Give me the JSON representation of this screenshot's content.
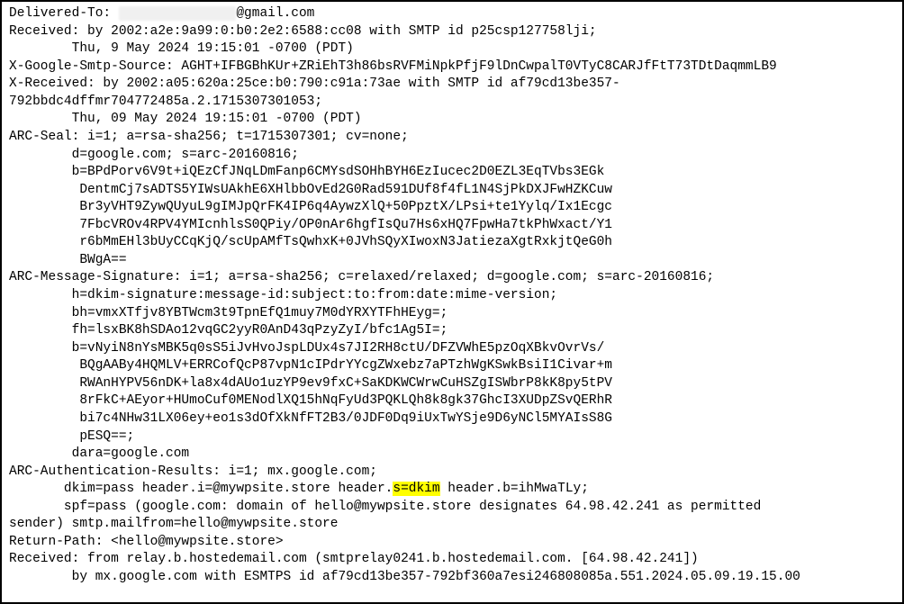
{
  "lines": {
    "l01a": "Delivered-To: ",
    "l01_redacted": "xxxxx.xxxxxxxxx",
    "l01b": "@gmail.com",
    "l02": "Received: by 2002:a2e:9a99:0:b0:2e2:6588:cc08 with SMTP id p25csp127758lji;",
    "l03": "        Thu, 9 May 2024 19:15:01 -0700 (PDT)",
    "l04": "X-Google-Smtp-Source: AGHT+IFBGBhKUr+ZRiEhT3h86bsRVFMiNpkPfjF9lDnCwpalT0VTyC8CARJfFtT73TDtDaqmmLB9",
    "l05": "X-Received: by 2002:a05:620a:25ce:b0:790:c91a:73ae with SMTP id af79cd13be357-",
    "l06": "792bbdc4dffmr704772485a.2.1715307301053;",
    "l07": "        Thu, 09 May 2024 19:15:01 -0700 (PDT)",
    "l08": "ARC-Seal: i=1; a=rsa-sha256; t=1715307301; cv=none;",
    "l09": "        d=google.com; s=arc-20160816;",
    "l10": "        b=BPdPorv6V9t+iQEzCfJNqLDmFanp6CMYsdSOHhBYH6EzIucec2D0EZL3EqTVbs3EGk",
    "l11": "         DentmCj7sADTS5YIWsUAkhE6XHlbbOvEd2G0Rad591DUf8f4fL1N4SjPkDXJFwHZKCuw",
    "l12": "         Br3yVHT9ZywQUyuL9gIMJpQrFK4IP6q4AywzXlQ+50PpztX/LPsi+te1Yylq/Ix1Ecgc",
    "l13": "         7FbcVROv4RPV4YMIcnhlsS0QPiy/OP0nAr6hgfIsQu7Hs6xHQ7FpwHa7tkPhWxact/Y1",
    "l14": "         r6bMmEHl3bUyCCqKjQ/scUpAMfTsQwhxK+0JVhSQyXIwoxN3JatiezaXgtRxkjtQeG0h",
    "l15": "         BWgA==",
    "l16": "ARC-Message-Signature: i=1; a=rsa-sha256; c=relaxed/relaxed; d=google.com; s=arc-20160816;",
    "l17": "        h=dkim-signature:message-id:subject:to:from:date:mime-version;",
    "l18": "        bh=vmxXTfjv8YBTWcm3t9TpnEfQ1muy7M0dYRXYTFhHEyg=;",
    "l19": "        fh=lsxBK8hSDAo12vqGC2yyR0AnD43qPzyZyI/bfc1Ag5I=;",
    "l20": "        b=vNyiN8nYsMBK5q0sS5iJvHvoJspLDUx4s7JI2RH8ctU/DFZVWhE5pzOqXBkvOvrVs/",
    "l21": "         BQgAABy4HQMLV+ERRCofQcP87vpN1cIPdrYYcgZWxebz7aPTzhWgKSwkBsiI1Civar+m",
    "l22": "         RWAnHYPV56nDK+la8x4dAUo1uzYP9ev9fxC+SaKDKWCWrwCuHSZgISWbrP8kK8py5tPV",
    "l23": "         8rFkC+AEyor+HUmoCuf0MENodlXQ15hNqFyUd3PQKLQh8k8gk37GhcI3XUDpZSvQERhR",
    "l24": "         bi7c4NHw31LX06ey+eo1s3dOfXkNfFT2B3/0JDF0Dq9iUxTwYSje9D6yNCl5MYAIsS8G",
    "l25": "         pESQ==;",
    "l26": "        dara=google.com",
    "l27": "ARC-Authentication-Results: i=1; mx.google.com;",
    "l28a": "       dkim=pass header.i=@mywpsite.store header.",
    "l28_hl": "s=dkim",
    "l28b": " header.b=ihMwaTLy;",
    "l29": "       spf=pass (google.com: domain of hello@mywpsite.store designates 64.98.42.241 as permitted",
    "l30": "sender) smtp.mailfrom=hello@mywpsite.store",
    "l31": "Return-Path: <hello@mywpsite.store>",
    "l32": "Received: from relay.b.hostedemail.com (smtprelay0241.b.hostedemail.com. [64.98.42.241])",
    "l33": "        by mx.google.com with ESMTPS id af79cd13be357-792bf360a7esi246808085a.551.2024.05.09.19.15.00"
  }
}
